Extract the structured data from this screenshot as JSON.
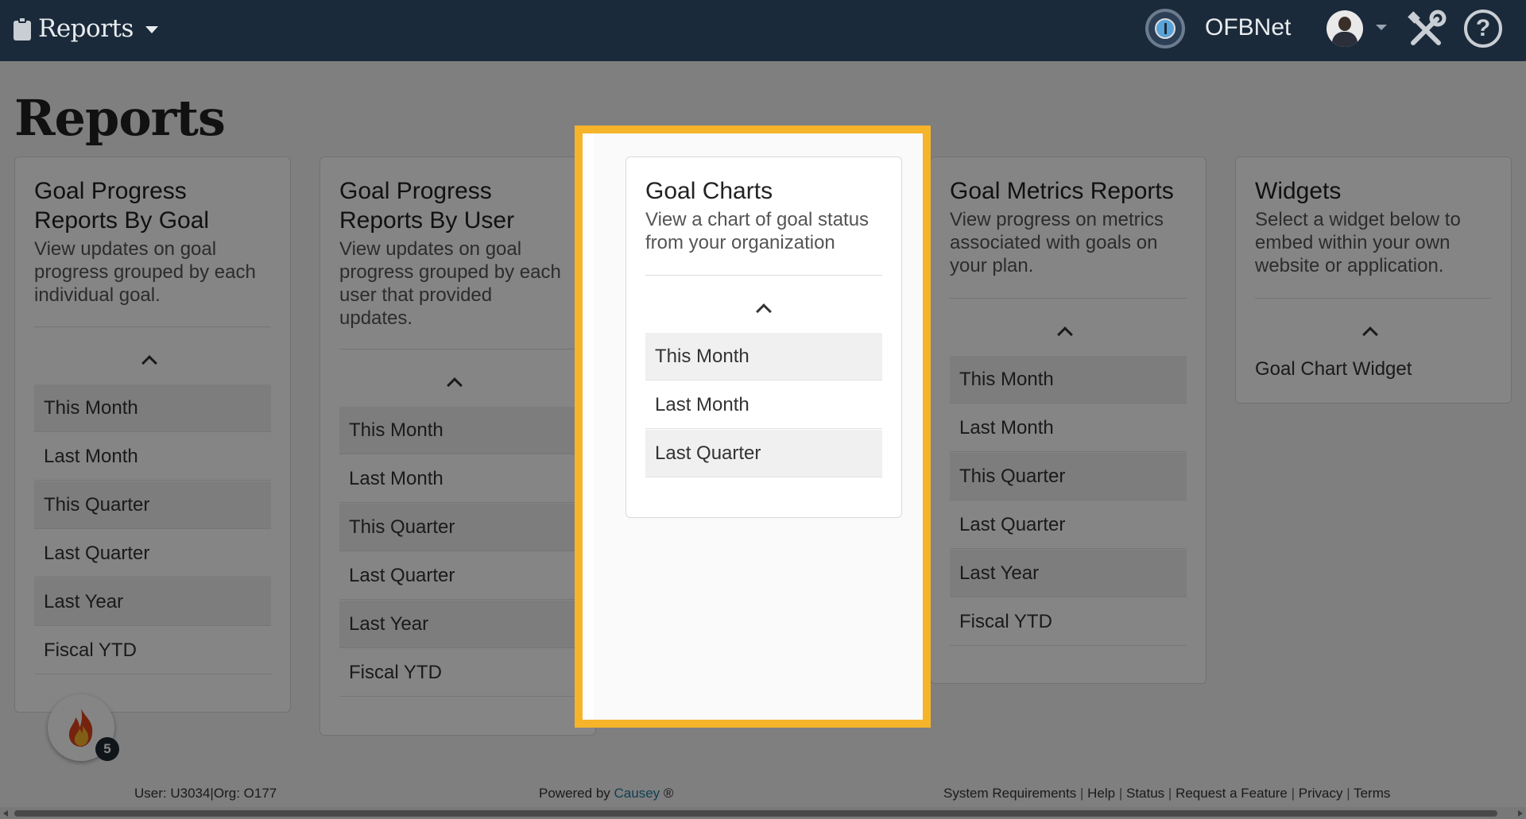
{
  "navbar": {
    "brand": "Reports",
    "org_name": "OFBNet"
  },
  "page": {
    "title": "Reports"
  },
  "cards": {
    "by_goal": {
      "title_line1": "Goal Progress",
      "title_line2": "Reports By Goal",
      "desc_line1": "View updates on goal",
      "desc_line2": "progress grouped by each",
      "desc_line3": "individual goal.",
      "items": [
        "This Month",
        "Last Month",
        "This Quarter",
        "Last Quarter",
        "Last Year",
        "Fiscal YTD"
      ]
    },
    "by_user": {
      "title_line1": "Goal Progress",
      "title_line2": "Reports By User",
      "desc_line1": "View updates on goal",
      "desc_line2": "progress grouped by each",
      "desc_line3": "user that provided",
      "desc_line4": "updates.",
      "items": [
        "This Month",
        "Last Month",
        "This Quarter",
        "Last Quarter",
        "Last Year",
        "Fiscal YTD"
      ]
    },
    "goal_charts": {
      "title": "Goal Charts",
      "desc_line1": "View a chart of goal status",
      "desc_line2": "from your organization",
      "items": [
        "This Month",
        "Last Month",
        "Last Quarter"
      ]
    },
    "goal_metrics": {
      "title": "Goal Metrics Reports",
      "desc_line1": "View progress on metrics",
      "desc_line2": "associated with goals on",
      "desc_line3": "your plan.",
      "items": [
        "This Month",
        "Last Month",
        "This Quarter",
        "Last Quarter",
        "Last Year",
        "Fiscal YTD"
      ]
    },
    "widgets": {
      "title": "Widgets",
      "desc_line1": "Select a widget below to",
      "desc_line2": "embed within your own",
      "desc_line3": "website or application.",
      "items": [
        "Goal Chart Widget"
      ]
    }
  },
  "fire_badge": {
    "count": "5"
  },
  "footer": {
    "user_info": "User: U3034|Org: O177",
    "powered_prefix": "Powered by",
    "powered_brand": "Causey",
    "powered_mark": "®",
    "links": [
      "System Requirements",
      "Help",
      "Status",
      "Request a Feature",
      "Privacy",
      "Terms"
    ],
    "separator": "|"
  },
  "colors": {
    "navbar_bg": "#1b2a3a",
    "highlight_border": "#f6b42b",
    "link": "#1e7a9c"
  }
}
